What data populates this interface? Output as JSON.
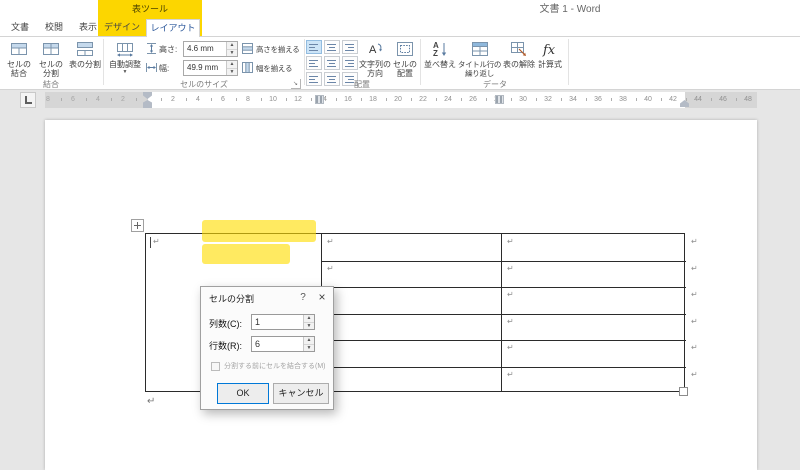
{
  "titlebar": {
    "contextual_tool": "表ツール",
    "document_title": "文書 1 - Word"
  },
  "tabs": {
    "left": [
      "文書",
      "校閲",
      "表示"
    ],
    "contextual": [
      "デザイン",
      "レイアウト"
    ],
    "active_tab": "レイアウト"
  },
  "ribbon": {
    "merge_group": {
      "label": "結合",
      "merge_cells": "セルの結合",
      "split_cells": "セルの分割",
      "split_table": "表の分割"
    },
    "cell_size_group": {
      "label": "セルのサイズ",
      "autofit": "自動調整",
      "height_label": "高さ:",
      "height_value": "4.6 mm",
      "width_label": "幅:",
      "width_value": "49.9 mm",
      "distribute_rows": "高さを揃える",
      "distribute_columns": "幅を揃える"
    },
    "alignment_group": {
      "label": "配置",
      "text_direction": "文字列の方向",
      "cell_margins": "セルの配置",
      "selected_index": 0,
      "buttons": [
        "align-top-left-button",
        "align-top-center-button",
        "align-top-right-button",
        "align-middle-left-button",
        "align-middle-center-button",
        "align-middle-right-button",
        "align-bottom-left-button",
        "align-bottom-center-button",
        "align-bottom-right-button"
      ]
    },
    "data_group": {
      "label": "データ",
      "sort": "並べ替え",
      "repeat_header_rows": "タイトル行の繰り返し",
      "convert_to_text": "表の解除",
      "formula": "計算式"
    }
  },
  "ruler": {
    "numbers": [
      2,
      4,
      6,
      8,
      10,
      12,
      14,
      16,
      18,
      20,
      22,
      24,
      26,
      28,
      30,
      32,
      34,
      36,
      38,
      40,
      42,
      44,
      46,
      48
    ],
    "margin_numbers": [
      2,
      4,
      6,
      8
    ]
  },
  "document": {
    "table": {
      "rows": 6,
      "columns": 3,
      "cell_marker": "↵",
      "paragraph_marker": "↵"
    }
  },
  "dialog": {
    "title": "セルの分割",
    "help_icon": "?",
    "close_icon": "×",
    "columns_label": "列数(C):",
    "columns_value": "1",
    "rows_label": "行数(R):",
    "rows_value": "6",
    "merge_before_split_label": "分割する前にセルを結合する(M)",
    "ok_label": "OK",
    "cancel_label": "キャンセル"
  },
  "icons": {
    "spin_up": "▲",
    "spin_down": "▼",
    "dropdown_arrow": "▼",
    "dialog_launcher": "↘",
    "formula": "fx",
    "sort_a": "A",
    "sort_z": "Z",
    "text_direction_letter": "A"
  },
  "colors": {
    "contextual_yellow": "#fcd600",
    "active_tab_text": "#2b579a",
    "highlight_annotation": "rgba(255,221,0,0.62)",
    "window_gray": "#e6e6e6"
  }
}
